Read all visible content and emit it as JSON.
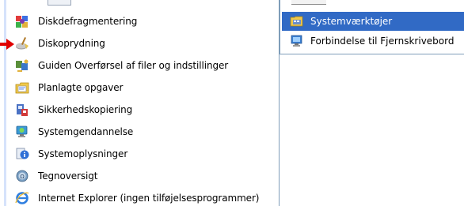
{
  "main_menu": {
    "items": [
      {
        "label": "Diskdefragmentering",
        "icon": "disk-defragmenter-icon"
      },
      {
        "label": "Diskoprydning",
        "icon": "disk-cleanup-icon"
      },
      {
        "label": "Guiden Overførsel af filer og indstillinger",
        "icon": "files-settings-transfer-icon"
      },
      {
        "label": "Planlagte opgaver",
        "icon": "scheduled-tasks-icon"
      },
      {
        "label": "Sikkerhedskopiering",
        "icon": "backup-icon"
      },
      {
        "label": "Systemgendannelse",
        "icon": "system-restore-icon"
      },
      {
        "label": "Systemoplysninger",
        "icon": "system-information-icon"
      },
      {
        "label": "Tegnoversigt",
        "icon": "character-map-icon"
      },
      {
        "label": "Internet Explorer (ingen tilføjelsesprogrammer)",
        "icon": "internet-explorer-icon"
      }
    ]
  },
  "sub_menu": {
    "items": [
      {
        "label": "Systemværktøjer",
        "icon": "system-tools-folder-icon",
        "selected": true
      },
      {
        "label": "Forbindelse til Fjernskrivebord",
        "icon": "remote-desktop-icon",
        "selected": false
      }
    ]
  },
  "colors": {
    "selection": "#316ac5",
    "menu_border": "#7f9db9",
    "pointer_arrow": "#e00000"
  }
}
